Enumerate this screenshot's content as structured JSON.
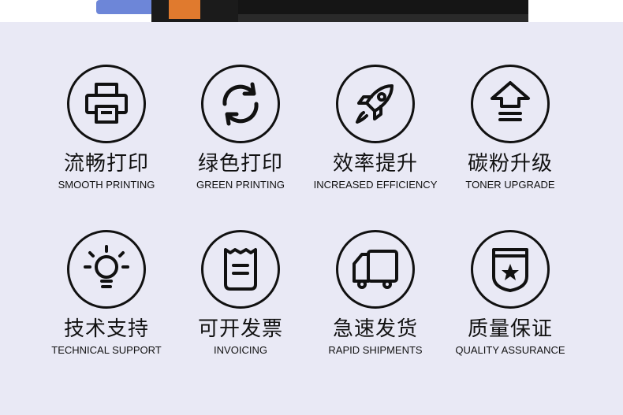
{
  "features": [
    {
      "cn": "流畅打印",
      "en": "SMOOTH PRINTING",
      "icon": "printer-icon"
    },
    {
      "cn": "绿色打印",
      "en": "GREEN PRINTING",
      "icon": "recycle-icon"
    },
    {
      "cn": "效率提升",
      "en": "INCREASED EFFICIENCY",
      "icon": "rocket-icon"
    },
    {
      "cn": "碳粉升级",
      "en": "TONER UPGRADE",
      "icon": "upgrade-arrow-icon"
    },
    {
      "cn": "技术支持",
      "en": "TECHNICAL SUPPORT",
      "icon": "lightbulb-icon"
    },
    {
      "cn": "可开发票",
      "en": "INVOICING",
      "icon": "receipt-icon"
    },
    {
      "cn": "急速发货",
      "en": "RAPID SHIPMENTS",
      "icon": "truck-icon"
    },
    {
      "cn": "质量保证",
      "en": "QUALITY ASSURANCE",
      "icon": "shield-star-icon"
    }
  ],
  "colors": {
    "background": "#e9e9f5",
    "ink": "#111111"
  }
}
